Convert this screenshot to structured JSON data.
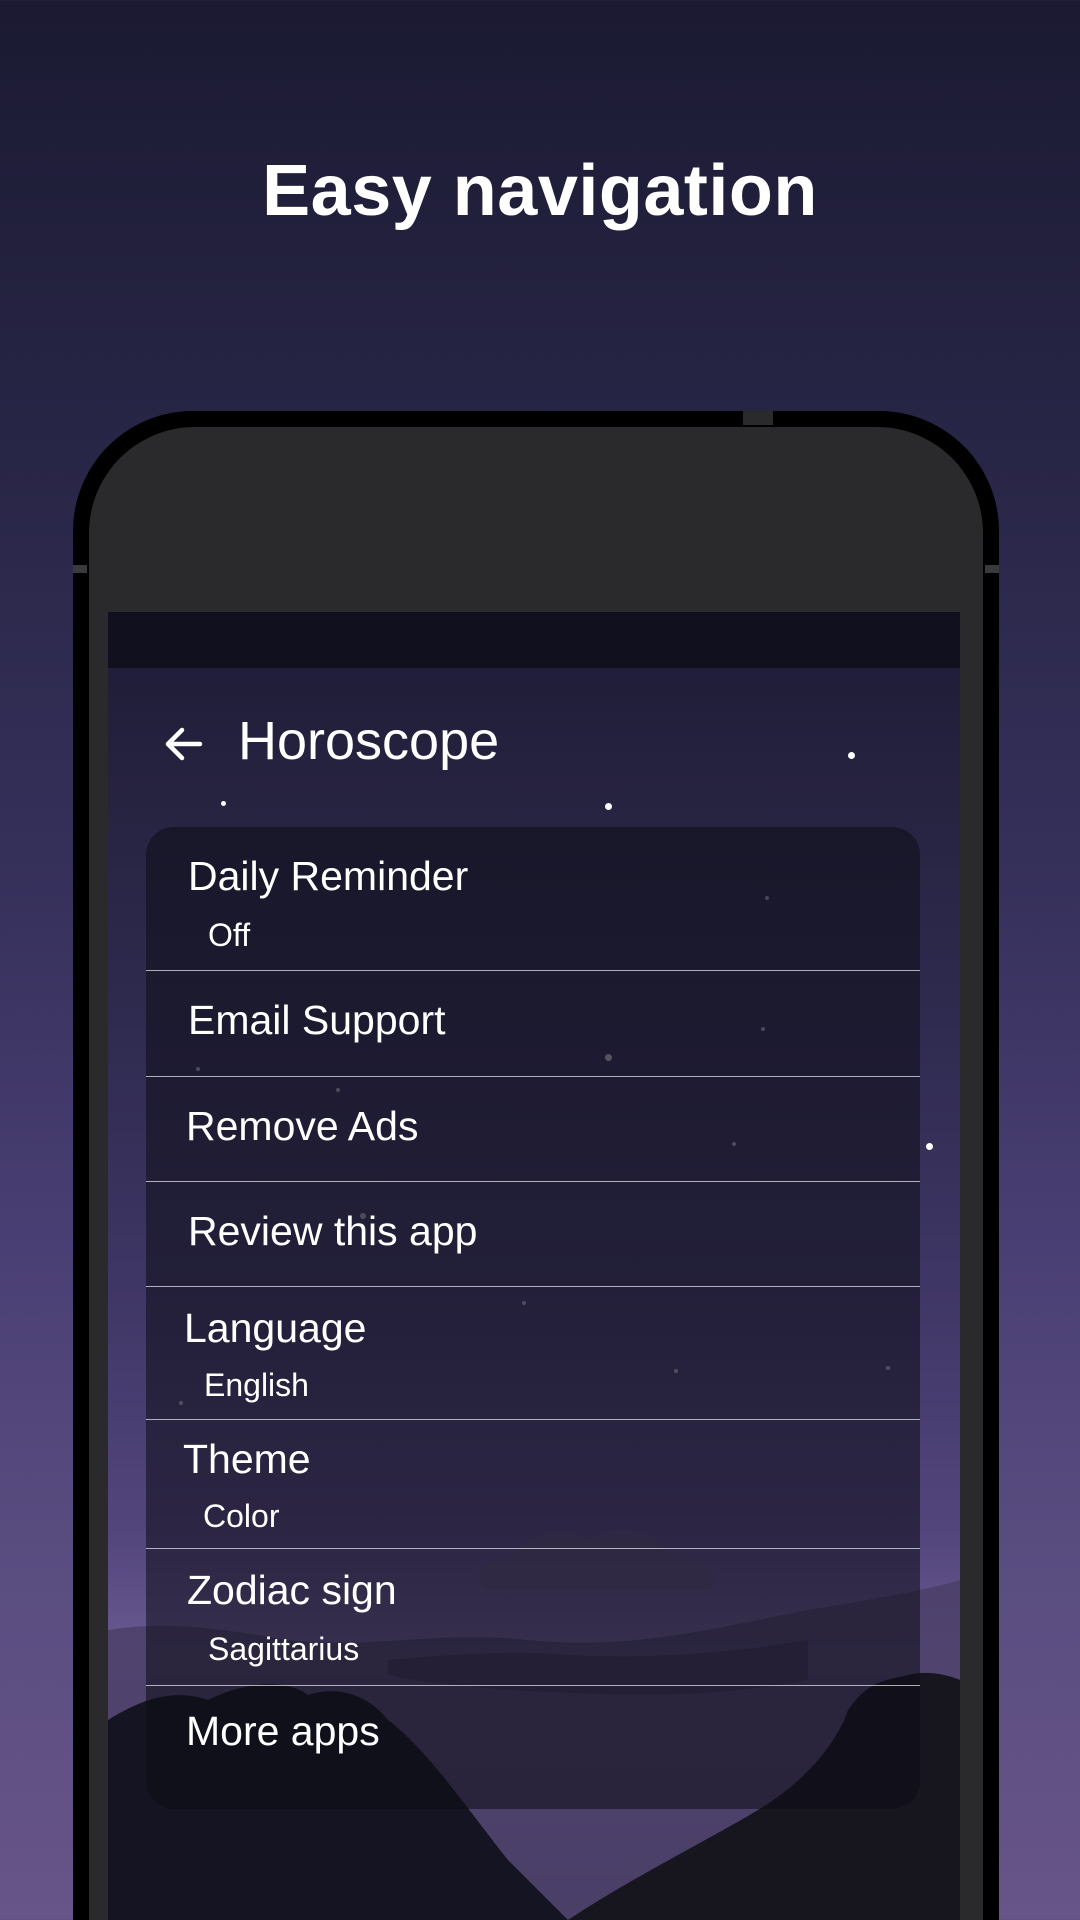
{
  "headline": "Easy navigation",
  "app_bar": {
    "back_icon": "arrow-left-icon",
    "title": "Horoscope"
  },
  "settings": {
    "items": [
      {
        "title": "Daily Reminder",
        "subtitle": "Off"
      },
      {
        "title": "Email Support",
        "subtitle": ""
      },
      {
        "title": "Remove Ads",
        "subtitle": ""
      },
      {
        "title": "Review this app",
        "subtitle": ""
      },
      {
        "title": "Language",
        "subtitle": "English"
      },
      {
        "title": "Theme",
        "subtitle": "Color"
      },
      {
        "title": "Zodiac sign",
        "subtitle": "Sagittarius"
      },
      {
        "title": "More apps",
        "subtitle": ""
      }
    ]
  },
  "colors": {
    "background_top": "#1b1a32",
    "background_bottom": "#675488",
    "phone_frame": "#000000",
    "phone_body": "#2a2a2c",
    "status_bar": "#11101e",
    "text": "#ffffff"
  }
}
